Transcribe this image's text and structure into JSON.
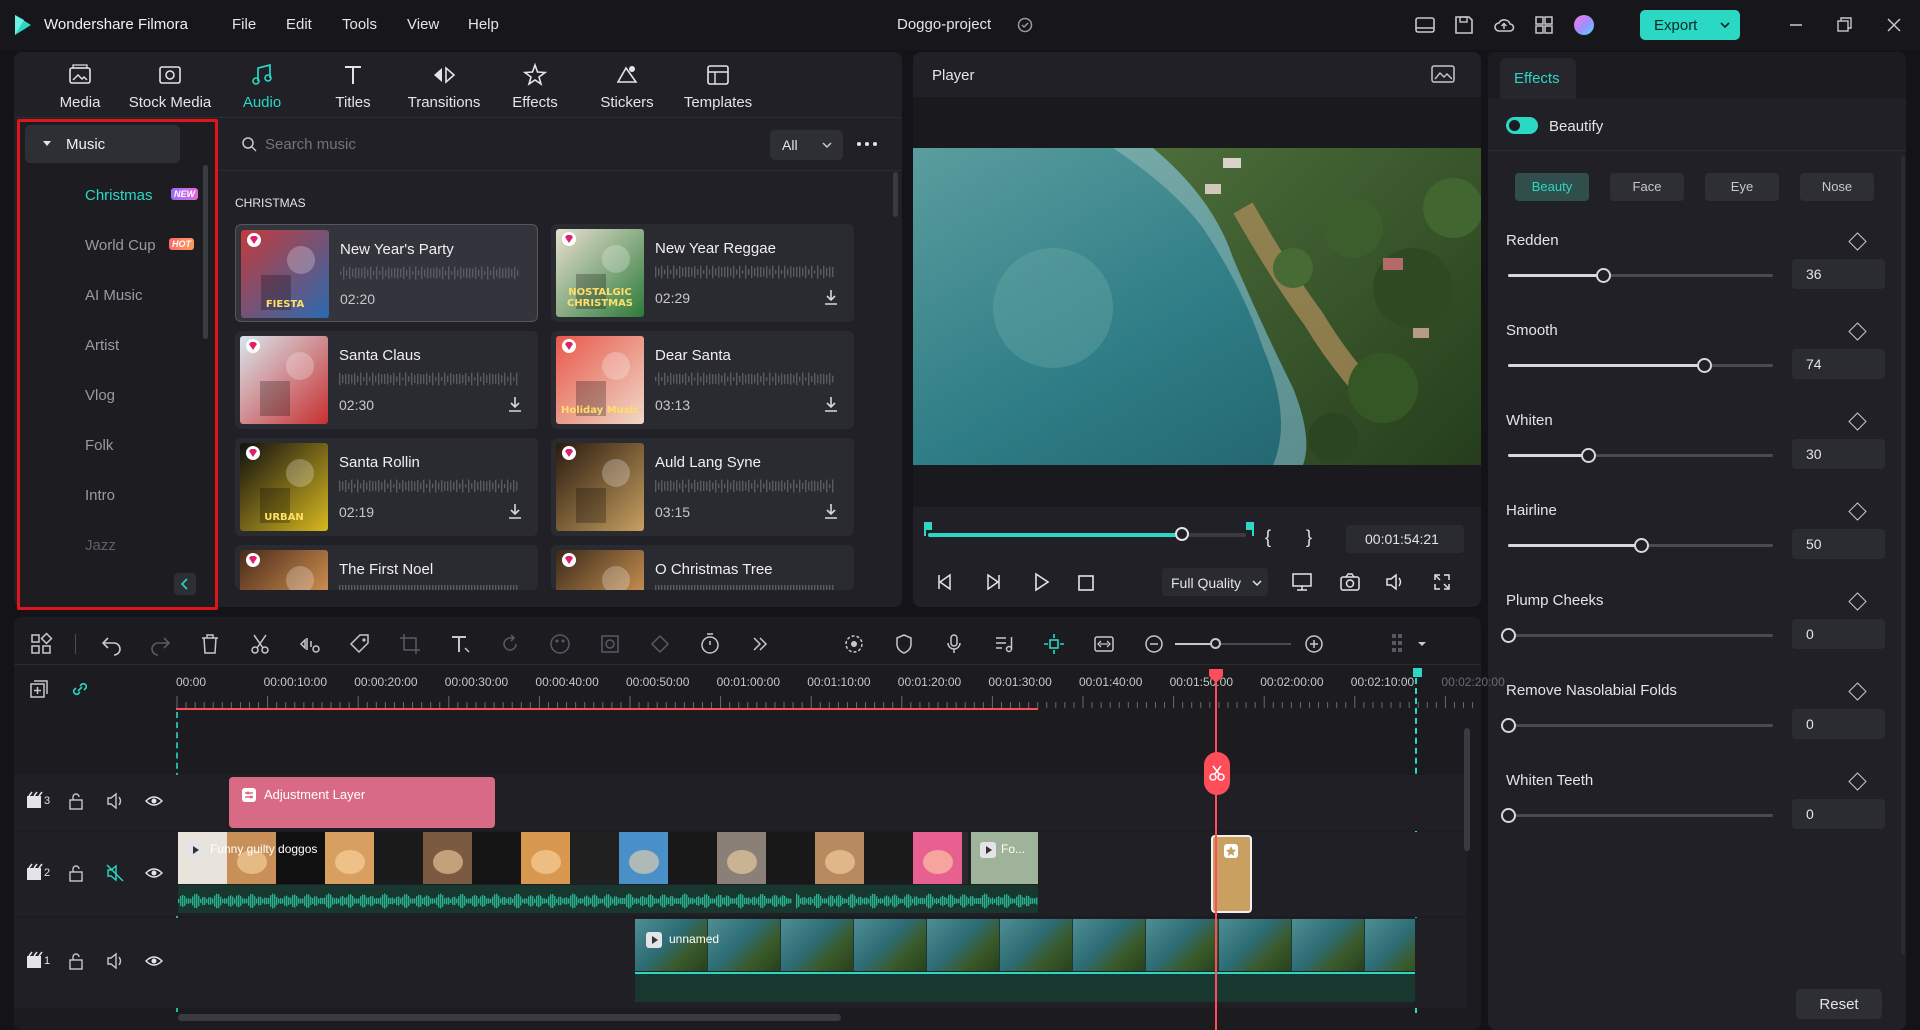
{
  "app": {
    "name": "Wondershare Filmora",
    "project": "Doggo-project",
    "export_label": "Export"
  },
  "menu": [
    "File",
    "Edit",
    "Tools",
    "View",
    "Help"
  ],
  "colors": {
    "accent": "#2ad8c4",
    "highlight_box": "#e0151c",
    "playhead": "#ff4d5a",
    "adjustment_layer": "#d96a86"
  },
  "tool_tabs": [
    {
      "label": "Media",
      "icon": "media-icon"
    },
    {
      "label": "Stock Media",
      "icon": "stock-media-icon"
    },
    {
      "label": "Audio",
      "icon": "music-note-icon",
      "active": true
    },
    {
      "label": "Titles",
      "icon": "titles-icon"
    },
    {
      "label": "Transitions",
      "icon": "transitions-icon"
    },
    {
      "label": "Effects",
      "icon": "effects-icon"
    },
    {
      "label": "Stickers",
      "icon": "stickers-icon"
    },
    {
      "label": "Templates",
      "icon": "templates-icon"
    }
  ],
  "sidebar": {
    "root": "Music",
    "items": [
      {
        "label": "Christmas",
        "badge": "NEW",
        "active": true
      },
      {
        "label": "World Cup",
        "badge": "HOT"
      },
      {
        "label": "AI Music"
      },
      {
        "label": "Artist"
      },
      {
        "label": "Vlog"
      },
      {
        "label": "Folk"
      },
      {
        "label": "Intro"
      },
      {
        "label": "Jazz"
      }
    ]
  },
  "search": {
    "placeholder": "Search music",
    "filter": "All"
  },
  "section_title": "CHRISTMAS",
  "tracks": [
    {
      "title": "New Year's Party",
      "duration": "02:20",
      "thumb_text": "FIESTA"
    },
    {
      "title": "New Year Reggae",
      "duration": "02:29",
      "thumb_text": "NOSTALGIC CHRISTMAS"
    },
    {
      "title": "Santa Claus",
      "duration": "02:30",
      "thumb_text": ""
    },
    {
      "title": "Dear Santa",
      "duration": "03:13",
      "thumb_text": "Holiday Music"
    },
    {
      "title": "Santa Rollin",
      "duration": "02:19",
      "thumb_text": "URBAN"
    },
    {
      "title": "Auld Lang Syne",
      "duration": "03:15",
      "thumb_text": ""
    },
    {
      "title": "The First Noel",
      "duration": "",
      "thumb_text": ""
    },
    {
      "title": "O Christmas Tree",
      "duration": "",
      "thumb_text": ""
    }
  ],
  "player": {
    "title": "Player",
    "timecode": "00:01:54:21",
    "quality": "Full Quality",
    "progress": 0.8,
    "mark_in": "{",
    "mark_out": "}"
  },
  "effects": {
    "tab": "Effects",
    "toggle_label": "Beautify",
    "subtabs": [
      "Beauty",
      "Face",
      "Eye",
      "Nose"
    ],
    "sliders": [
      {
        "label": "Redden",
        "value": "36",
        "fraction": 0.36
      },
      {
        "label": "Smooth",
        "value": "74",
        "fraction": 0.74
      },
      {
        "label": "Whiten",
        "value": "30",
        "fraction": 0.3
      },
      {
        "label": "Hairline",
        "value": "50",
        "fraction": 0.5
      },
      {
        "label": "Plump Cheeks",
        "value": "0",
        "fraction": 0
      },
      {
        "label": "Remove Nasolabial Folds",
        "value": "0",
        "fraction": 0
      },
      {
        "label": "Whiten Teeth",
        "value": "0",
        "fraction": 0
      }
    ],
    "reset_label": "Reset"
  },
  "timeline": {
    "ruler": [
      "00:00",
      "00:00:10:00",
      "00:00:20:00",
      "00:00:30:00",
      "00:00:40:00",
      "00:00:50:00",
      "00:01:00:00",
      "00:01:10:00",
      "00:01:20:00",
      "00:01:30:00",
      "00:01:40:00",
      "00:01:50:00",
      "00:02:00:00",
      "00:02:10:00",
      "00:02:20:00"
    ],
    "tracks": [
      {
        "num": "3"
      },
      {
        "num": "2"
      },
      {
        "num": "1"
      }
    ],
    "clips": {
      "adjustment": "Adjustment Layer",
      "video2": "Funny guilty doggos",
      "video2b": "Fo...",
      "video1": "unnamed"
    }
  }
}
